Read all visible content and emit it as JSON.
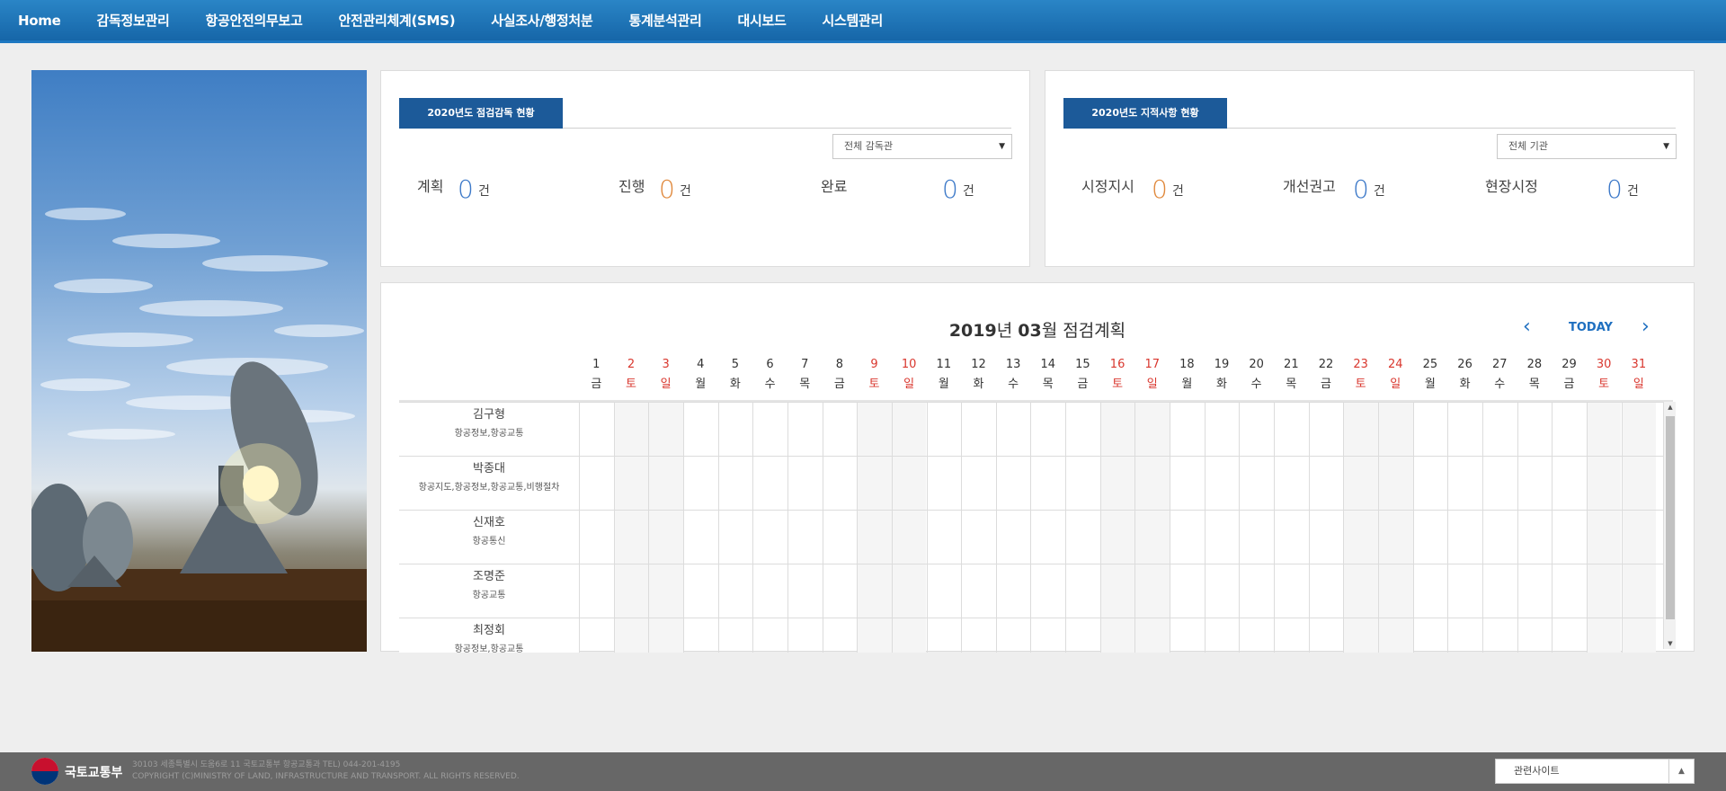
{
  "nav": {
    "items": [
      "Home",
      "감독정보관리",
      "항공안전의무보고",
      "안전관리체계(SMS)",
      "사실조사/행정처분",
      "통계분석관리",
      "대시보드",
      "시스템관리"
    ]
  },
  "inspection": {
    "tab": "2020년도 점검감독 현황",
    "select": "전체 감독관",
    "stats": [
      {
        "label": "계획",
        "value": "0",
        "unit": "건",
        "color": "#3b78c8"
      },
      {
        "label": "진행",
        "value": "0",
        "unit": "건",
        "color": "#e0883b"
      },
      {
        "label": "완료",
        "value": "0",
        "unit": "건",
        "color": "#3b78c8"
      }
    ]
  },
  "findings": {
    "tab": "2020년도 지적사항 현황",
    "select": "전체 기관",
    "stats": [
      {
        "label": "시정지시",
        "value": "0",
        "unit": "건",
        "color": "#e0883b"
      },
      {
        "label": "개선권고",
        "value": "0",
        "unit": "건",
        "color": "#3b78c8"
      },
      {
        "label": "현장시정",
        "value": "0",
        "unit": "건",
        "color": "#3b78c8"
      }
    ]
  },
  "calendar": {
    "year": "2019",
    "year_suffix": "년",
    "month": "03",
    "month_suffix": "월 점검계획",
    "today_label": "TODAY",
    "prev_icon": "chevron-left-icon",
    "next_icon": "chevron-right-icon",
    "days": [
      {
        "d": "1",
        "w": "금",
        "red": false
      },
      {
        "d": "2",
        "w": "토",
        "red": true
      },
      {
        "d": "3",
        "w": "일",
        "red": true
      },
      {
        "d": "4",
        "w": "월",
        "red": false
      },
      {
        "d": "5",
        "w": "화",
        "red": false
      },
      {
        "d": "6",
        "w": "수",
        "red": false
      },
      {
        "d": "7",
        "w": "목",
        "red": false
      },
      {
        "d": "8",
        "w": "금",
        "red": false
      },
      {
        "d": "9",
        "w": "토",
        "red": true
      },
      {
        "d": "10",
        "w": "일",
        "red": true
      },
      {
        "d": "11",
        "w": "월",
        "red": false
      },
      {
        "d": "12",
        "w": "화",
        "red": false
      },
      {
        "d": "13",
        "w": "수",
        "red": false
      },
      {
        "d": "14",
        "w": "목",
        "red": false
      },
      {
        "d": "15",
        "w": "금",
        "red": false
      },
      {
        "d": "16",
        "w": "토",
        "red": true
      },
      {
        "d": "17",
        "w": "일",
        "red": true
      },
      {
        "d": "18",
        "w": "월",
        "red": false
      },
      {
        "d": "19",
        "w": "화",
        "red": false
      },
      {
        "d": "20",
        "w": "수",
        "red": false
      },
      {
        "d": "21",
        "w": "목",
        "red": false
      },
      {
        "d": "22",
        "w": "금",
        "red": false
      },
      {
        "d": "23",
        "w": "토",
        "red": true
      },
      {
        "d": "24",
        "w": "일",
        "red": true
      },
      {
        "d": "25",
        "w": "월",
        "red": false
      },
      {
        "d": "26",
        "w": "화",
        "red": false
      },
      {
        "d": "27",
        "w": "수",
        "red": false
      },
      {
        "d": "28",
        "w": "목",
        "red": false
      },
      {
        "d": "29",
        "w": "금",
        "red": false
      },
      {
        "d": "30",
        "w": "토",
        "red": true
      },
      {
        "d": "31",
        "w": "일",
        "red": true
      }
    ],
    "inspectors": [
      {
        "name": "김구형",
        "fields": "항공정보,항공교통"
      },
      {
        "name": "박종대",
        "fields": "항공지도,항공정보,항공교통,비행절차"
      },
      {
        "name": "신재호",
        "fields": "항공통신"
      },
      {
        "name": "조명준",
        "fields": "항공교통"
      },
      {
        "name": "최정회",
        "fields": "항공정보,항공교통"
      }
    ]
  },
  "footer": {
    "org": "국토교통부",
    "address": "30103 세종특별시 도움6로 11 국토교통부 항공교통과 TEL) 044-201-4195",
    "copyright": "COPYRIGHT (C)MINISTRY OF LAND, INFRASTRUCTURE AND TRANSPORT. ALL RIGHTS RESERVED.",
    "related_sites": "관련사이트"
  }
}
